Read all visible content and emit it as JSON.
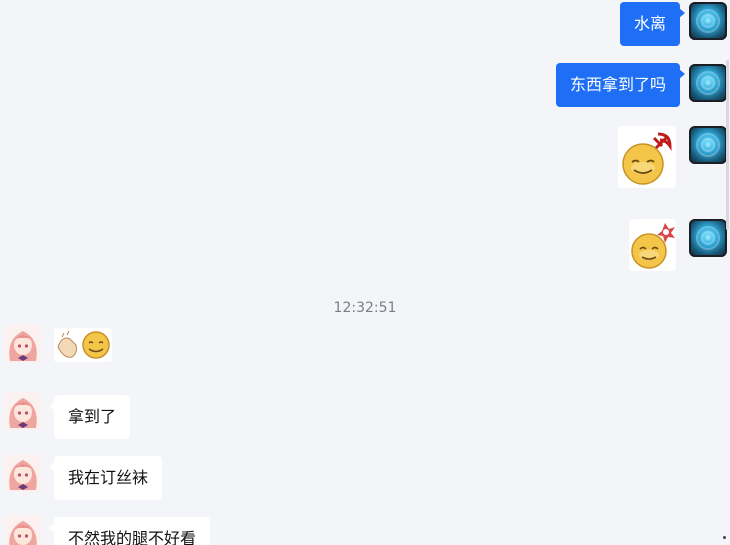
{
  "messages": {
    "m1": "水离",
    "m2": "东西拿到了吗",
    "m3": "拿到了",
    "m4": "我在订丝袜",
    "m5": "不然我的腿不好看"
  },
  "timestamp": "12:32:51",
  "stickers": {
    "s1": "smiley-hammer-sickle-sticker",
    "s2": "smiley-angry-sticker",
    "s3": "clap-smiley-sticker"
  },
  "colors": {
    "self_bubble": "#1e6ff5",
    "other_bubble": "#ffffff",
    "background": "#f3f5f8"
  }
}
